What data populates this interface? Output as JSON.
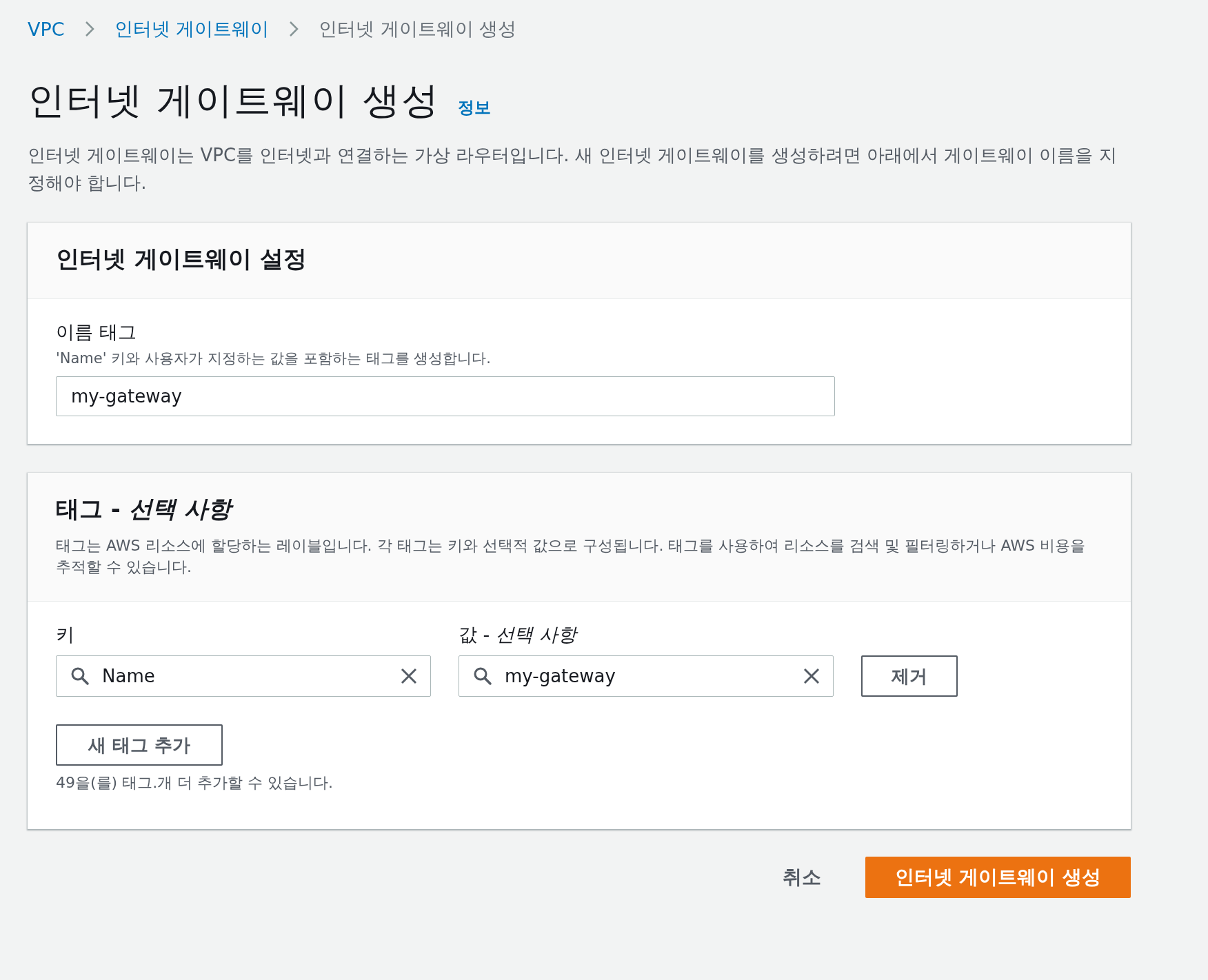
{
  "breadcrumb": [
    {
      "label": "VPC",
      "kind": "link"
    },
    {
      "label": "인터넷 게이트웨이",
      "kind": "link"
    },
    {
      "label": "인터넷 게이트웨이 생성",
      "kind": "current"
    }
  ],
  "page": {
    "title": "인터넷 게이트웨이 생성",
    "info": "정보",
    "description": "인터넷 게이트웨이는 VPC를 인터넷과 연결하는 가상 라우터입니다. 새 인터넷 게이트웨이를 생성하려면 아래에서 게이트웨이 이름을 지정해야 합니다."
  },
  "settings": {
    "title": "인터넷 게이트웨이 설정",
    "name_label": "이름 태그",
    "name_hint": "'Name' 키와 사용자가 지정하는 값을 포함하는 태그를 생성합니다.",
    "name_value": "my-gateway"
  },
  "tags": {
    "title": "태그 - *선택 사항*",
    "description": "태그는 AWS 리소스에 할당하는 레이블입니다. 각 태그는 키와 선택적 값으로 구성됩니다. 태그를 사용하여 리소스를 검색 및 필터링하거나 AWS 비용을 추적할 수 있습니다.",
    "key_label": "키",
    "value_label": "값 - *선택 사항*",
    "rows": [
      {
        "key": "Name",
        "value": "my-gateway",
        "remove": "제거"
      }
    ],
    "add_button": "새 태그 추가",
    "remaining": "49을(를) 태그.개 더 추가할 수 있습니다."
  },
  "footer": {
    "cancel": "취소",
    "submit": "인터넷 게이트웨이 생성"
  }
}
